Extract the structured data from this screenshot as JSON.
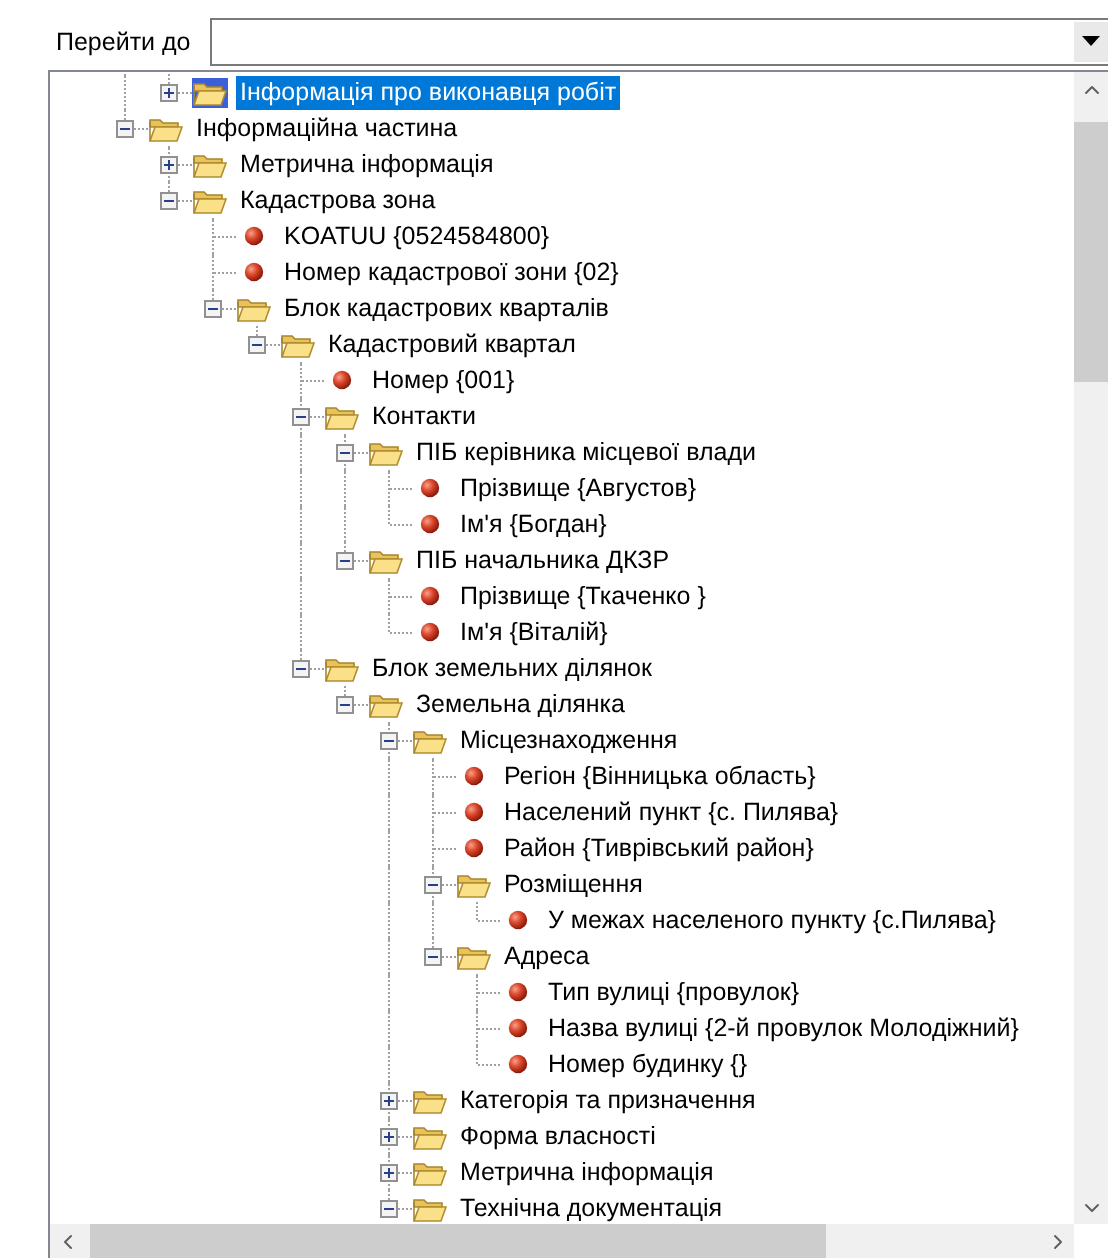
{
  "goto": {
    "label": "Перейти до"
  },
  "tree": {
    "hidden_parent_children": [
      {
        "label": "Інформація про виконавця робіт",
        "kind": "folder",
        "expanded": false,
        "selected": true
      }
    ],
    "items": [
      {
        "label": "Інформаційна частина",
        "kind": "folder",
        "expanded": true,
        "selected": false,
        "children": [
          {
            "label": "Метрична інформація",
            "kind": "folder",
            "expanded": false,
            "selected": false
          },
          {
            "label": "Кадастрова зона",
            "kind": "folder",
            "expanded": true,
            "selected": false,
            "children": [
              {
                "label": "KOATUU {0524584800}",
                "kind": "field",
                "selected": false
              },
              {
                "label": "Номер кадастрової зони {02}",
                "kind": "field",
                "selected": false
              },
              {
                "label": "Блок кадастрових кварталів",
                "kind": "folder",
                "expanded": true,
                "selected": false,
                "children": [
                  {
                    "label": "Кадастровий квартал",
                    "kind": "folder",
                    "expanded": true,
                    "selected": false,
                    "children": [
                      {
                        "label": "Номер {001}",
                        "kind": "field",
                        "selected": false
                      },
                      {
                        "label": "Контакти",
                        "kind": "folder",
                        "expanded": true,
                        "selected": false,
                        "children": [
                          {
                            "label": "ПІБ керівника місцевої влади",
                            "kind": "folder",
                            "expanded": true,
                            "selected": false,
                            "children": [
                              {
                                "label": "Прізвище {Августов}",
                                "kind": "field",
                                "selected": false
                              },
                              {
                                "label": "Ім'я {Богдан}",
                                "kind": "field",
                                "selected": false
                              }
                            ]
                          },
                          {
                            "label": "ПІБ начальника ДКЗР",
                            "kind": "folder",
                            "expanded": true,
                            "selected": false,
                            "children": [
                              {
                                "label": "Прізвище {Ткаченко }",
                                "kind": "field",
                                "selected": false
                              },
                              {
                                "label": "Ім'я {Віталій}",
                                "kind": "field",
                                "selected": false
                              }
                            ]
                          }
                        ]
                      },
                      {
                        "label": "Блок земельних ділянок",
                        "kind": "folder",
                        "expanded": true,
                        "selected": false,
                        "children": [
                          {
                            "label": "Земельна ділянка",
                            "kind": "folder",
                            "expanded": true,
                            "selected": false,
                            "children": [
                              {
                                "label": "Місцезнаходження",
                                "kind": "folder",
                                "expanded": true,
                                "selected": false,
                                "children": [
                                  {
                                    "label": "Регіон {Вінницька область}",
                                    "kind": "field",
                                    "selected": false
                                  },
                                  {
                                    "label": "Населений пункт {с. Пилява}",
                                    "kind": "field",
                                    "selected": false
                                  },
                                  {
                                    "label": "Район {Тиврівський район}",
                                    "kind": "field",
                                    "selected": false
                                  },
                                  {
                                    "label": "Розміщення",
                                    "kind": "folder",
                                    "expanded": true,
                                    "selected": false,
                                    "children": [
                                      {
                                        "label": "У межах населеного пункту {с.Пилява}",
                                        "kind": "field",
                                        "selected": false
                                      }
                                    ]
                                  },
                                  {
                                    "label": "Адреса",
                                    "kind": "folder",
                                    "expanded": true,
                                    "selected": false,
                                    "children": [
                                      {
                                        "label": "Тип вулиці {провулок}",
                                        "kind": "field",
                                        "selected": false
                                      },
                                      {
                                        "label": "Назва вулиці {2-й провулок Молодіжний}",
                                        "kind": "field",
                                        "selected": false
                                      },
                                      {
                                        "label": "Номер будинку {}",
                                        "kind": "field",
                                        "selected": false
                                      }
                                    ]
                                  }
                                ]
                              },
                              {
                                "label": "Категорія та призначення",
                                "kind": "folder",
                                "expanded": false,
                                "selected": false
                              },
                              {
                                "label": "Форма власності",
                                "kind": "folder",
                                "expanded": false,
                                "selected": false
                              },
                              {
                                "label": "Метрична інформація",
                                "kind": "folder",
                                "expanded": false,
                                "selected": false
                              },
                              {
                                "label": "Технічна документація",
                                "kind": "folder",
                                "expanded": true,
                                "selected": false
                              }
                            ]
                          }
                        ]
                      }
                    ]
                  }
                ]
              }
            ]
          }
        ]
      }
    ]
  }
}
